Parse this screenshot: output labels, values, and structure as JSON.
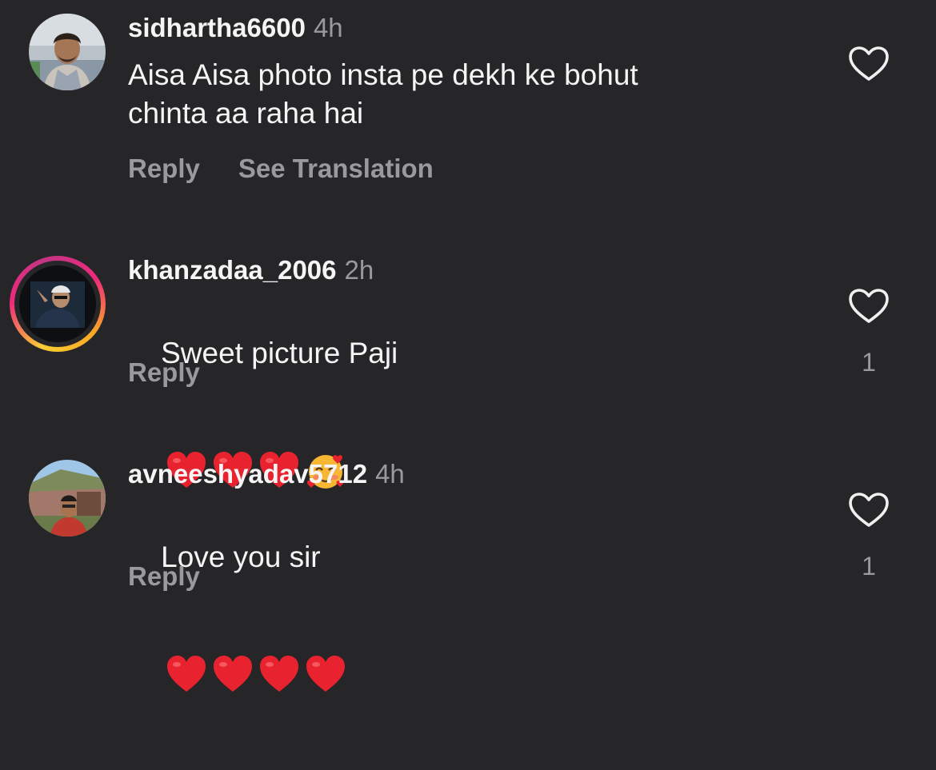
{
  "comments": [
    {
      "username": "sidhartha6600",
      "time": "4h",
      "text": "Aisa Aisa photo insta pe dekh ke bohut\nchinta aa raha hai",
      "reply_label": "Reply",
      "translation_label": "See Translation",
      "like_count": "",
      "avatar": "profile-photo",
      "emojis": []
    },
    {
      "username": "khanzadaa_2006",
      "time": "2h",
      "text": "Sweet picture Paji",
      "reply_label": "Reply",
      "like_count": "1",
      "avatar": "profile-photo-with-story-ring",
      "emojis": [
        "red-heart",
        "red-heart",
        "red-heart",
        "smiling-face-with-hearts"
      ]
    },
    {
      "username": "avneeshyadav5712",
      "time": "4h",
      "text": "Love you sir",
      "reply_label": "Reply",
      "like_count": "1",
      "avatar": "profile-photo",
      "emojis": [
        "red-heart",
        "red-heart",
        "red-heart",
        "red-heart"
      ]
    }
  ],
  "icons": {
    "like": "heart-outline-icon"
  },
  "colors": {
    "background": "#262527",
    "text_primary": "#f5f5f5",
    "text_secondary": "#9a9a9e",
    "heart": "#e8232f"
  }
}
